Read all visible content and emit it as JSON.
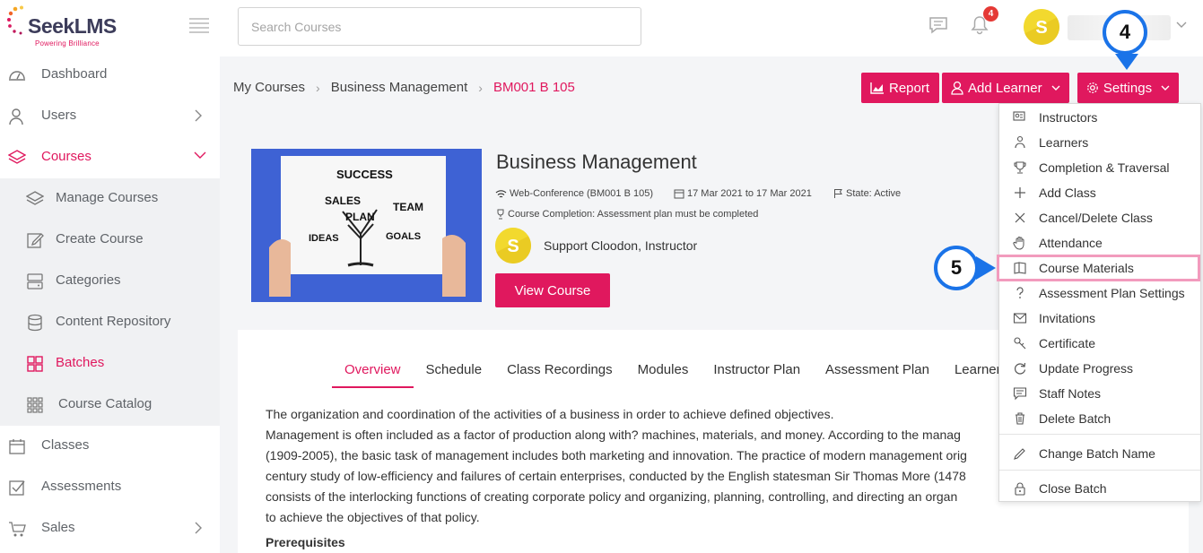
{
  "brand": {
    "name": "SeekLMS",
    "tagline": "Powering Brilliance"
  },
  "header": {
    "search_placeholder": "Search Courses",
    "notification_count": "4"
  },
  "sidebar": {
    "items": [
      {
        "label": "Dashboard",
        "icon": "dashboard-icon"
      },
      {
        "label": "Users",
        "icon": "users-icon"
      },
      {
        "label": "Courses",
        "icon": "courses-icon"
      },
      {
        "label": "Manage Courses",
        "icon": "layers-icon"
      },
      {
        "label": "Create Course",
        "icon": "edit-icon"
      },
      {
        "label": "Categories",
        "icon": "categories-icon"
      },
      {
        "label": "Content Repository",
        "icon": "database-icon"
      },
      {
        "label": "Batches",
        "icon": "grid-icon"
      },
      {
        "label": "Course Catalog",
        "icon": "catalog-icon"
      },
      {
        "label": "Classes",
        "icon": "calendar-icon"
      },
      {
        "label": "Assessments",
        "icon": "checkbox-icon"
      },
      {
        "label": "Sales",
        "icon": "cart-icon"
      }
    ]
  },
  "breadcrumb": {
    "items": [
      "My Courses",
      "Business Management",
      "BM001 B 105"
    ]
  },
  "actions": {
    "report": "Report",
    "add_learner": "Add Learner",
    "settings": "Settings"
  },
  "course": {
    "title": "Business Management",
    "delivery": "Web-Conference (BM001 B 105)",
    "dates": "17 Mar 2021 to 17 Mar 2021",
    "state": "State: Active",
    "completion": "Course Completion: Assessment plan must be completed",
    "instructor": "Support Cloodon, Instructor",
    "view_button": "View Course",
    "image_words": [
      "SUCCESS",
      "SALES",
      "TEAM",
      "PLAN",
      "IDEAS",
      "GOALS"
    ]
  },
  "tabs": [
    "Overview",
    "Schedule",
    "Class Recordings",
    "Modules",
    "Instructor Plan",
    "Assessment Plan",
    "Learners"
  ],
  "overview": {
    "lines": [
      "The organization and coordination of the activities of a business in order to achieve defined objectives.",
      "Management is often included as a factor of production along with? machines, materials, and money. According to the manag",
      "(1909-2005), the basic task of management includes both marketing and innovation. The practice of modern management orig",
      "century study of low-efficiency and failures of certain enterprises, conducted by the English statesman Sir Thomas More (1478",
      "consists of the interlocking functions of creating corporate policy and organizing, planning, controlling, and directing an organ",
      "to achieve the objectives of that policy."
    ],
    "prerequisites_heading": "Prerequisites"
  },
  "settings_menu": {
    "items": [
      {
        "label": "Instructors",
        "icon": "instructors-icon"
      },
      {
        "label": "Learners",
        "icon": "learners-icon"
      },
      {
        "label": "Completion & Traversal",
        "icon": "trophy-icon"
      },
      {
        "label": "Add Class",
        "icon": "plus-icon"
      },
      {
        "label": "Cancel/Delete Class",
        "icon": "x-icon"
      },
      {
        "label": "Attendance",
        "icon": "hand-icon"
      },
      {
        "label": "Course Materials",
        "icon": "book-icon"
      },
      {
        "label": "Assessment Plan Settings",
        "icon": "question-icon"
      },
      {
        "label": "Invitations",
        "icon": "envelope-icon"
      },
      {
        "label": "Certificate",
        "icon": "certificate-icon"
      },
      {
        "label": "Update Progress",
        "icon": "refresh-icon"
      },
      {
        "label": "Staff Notes",
        "icon": "notes-icon"
      },
      {
        "label": "Delete Batch",
        "icon": "trash-icon"
      },
      {
        "label": "Change Batch Name",
        "icon": "pencil-icon"
      },
      {
        "label": "Close Batch",
        "icon": "lock-icon"
      }
    ],
    "highlighted": "Course Materials"
  },
  "callouts": {
    "step_settings": "4",
    "step_materials": "5"
  },
  "colors": {
    "accent": "#e0185e",
    "callout": "#1a73e8",
    "highlight": "#f29bbd"
  }
}
